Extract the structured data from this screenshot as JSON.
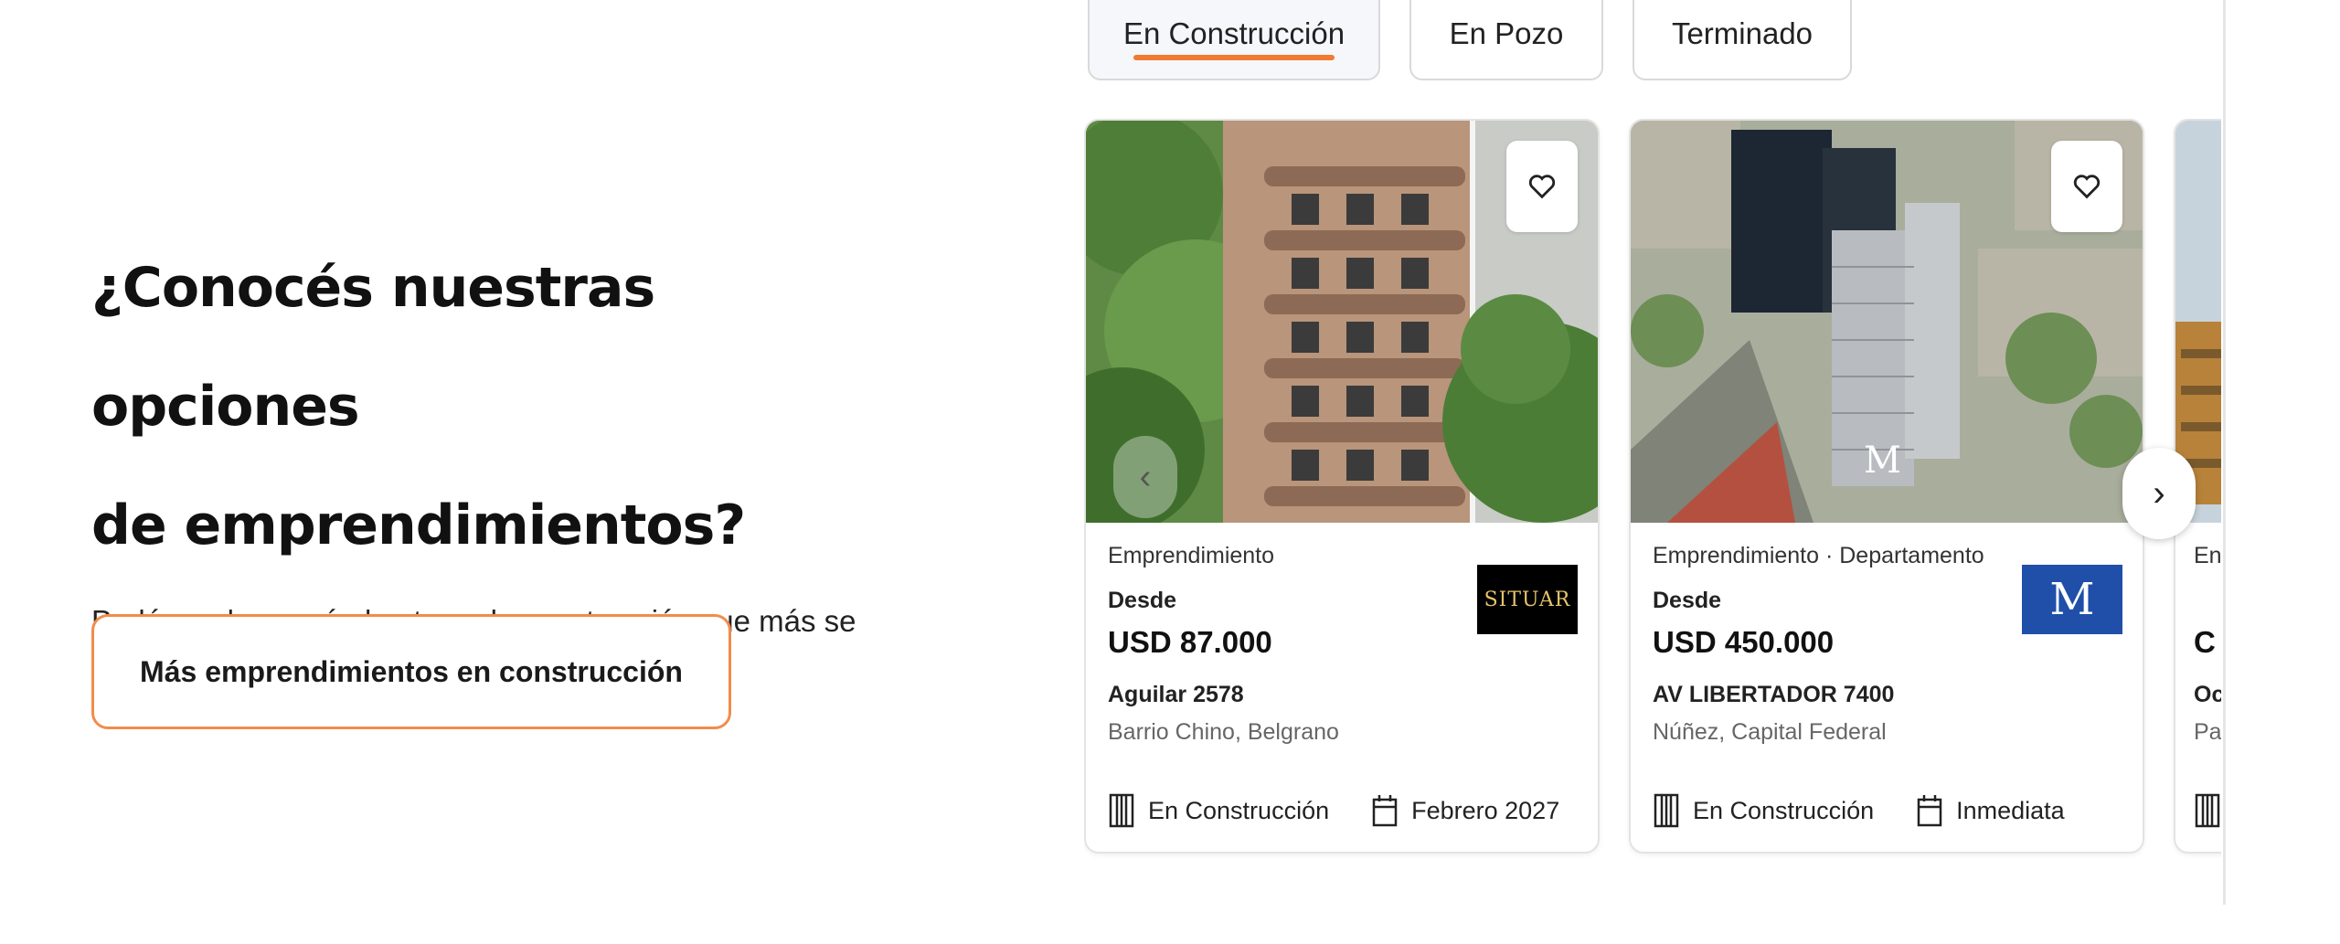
{
  "intro": {
    "headline_line1": "¿Conocés nuestras opciones",
    "headline_line2": "de emprendimientos?",
    "subtitle": "Podés verlos según la etapa de construcción que más se ajusta a tu búsqueda.",
    "cta": "Más emprendimientos en construcción"
  },
  "tabs": [
    {
      "label": "En Construcción",
      "active": true
    },
    {
      "label": "En Pozo",
      "active": false
    },
    {
      "label": "Terminado",
      "active": false
    }
  ],
  "cards": [
    {
      "type": "Emprendimiento",
      "from_label": "Desde",
      "price": "USD 87.000",
      "address": "Aguilar 2578",
      "area": "Barrio Chino, Belgrano",
      "stage": "En Construcción",
      "delivery": "Febrero 2027",
      "developer_logo": "SITUAR"
    },
    {
      "type": "Emprendimiento · Departamento",
      "from_label": "Desde",
      "price": "USD 450.000",
      "address": "AV LIBERTADOR 7400",
      "area": "Núñez, Capital Federal",
      "stage": "En Construcción",
      "delivery": "Inmediata",
      "developer_logo": "M"
    },
    {
      "type_partial": "En",
      "price_partial": "C",
      "address_partial": "Oc",
      "area_partial": "Pa"
    }
  ],
  "icons": {
    "favorite": "heart-outline-icon",
    "prev": "chevron-left-icon",
    "next": "chevron-right-icon",
    "stage": "building-icon",
    "delivery": "calendar-icon"
  },
  "colors": {
    "accent": "#f07c33",
    "logo_dark": "#000000",
    "logo_blue": "#1f4fa8"
  }
}
